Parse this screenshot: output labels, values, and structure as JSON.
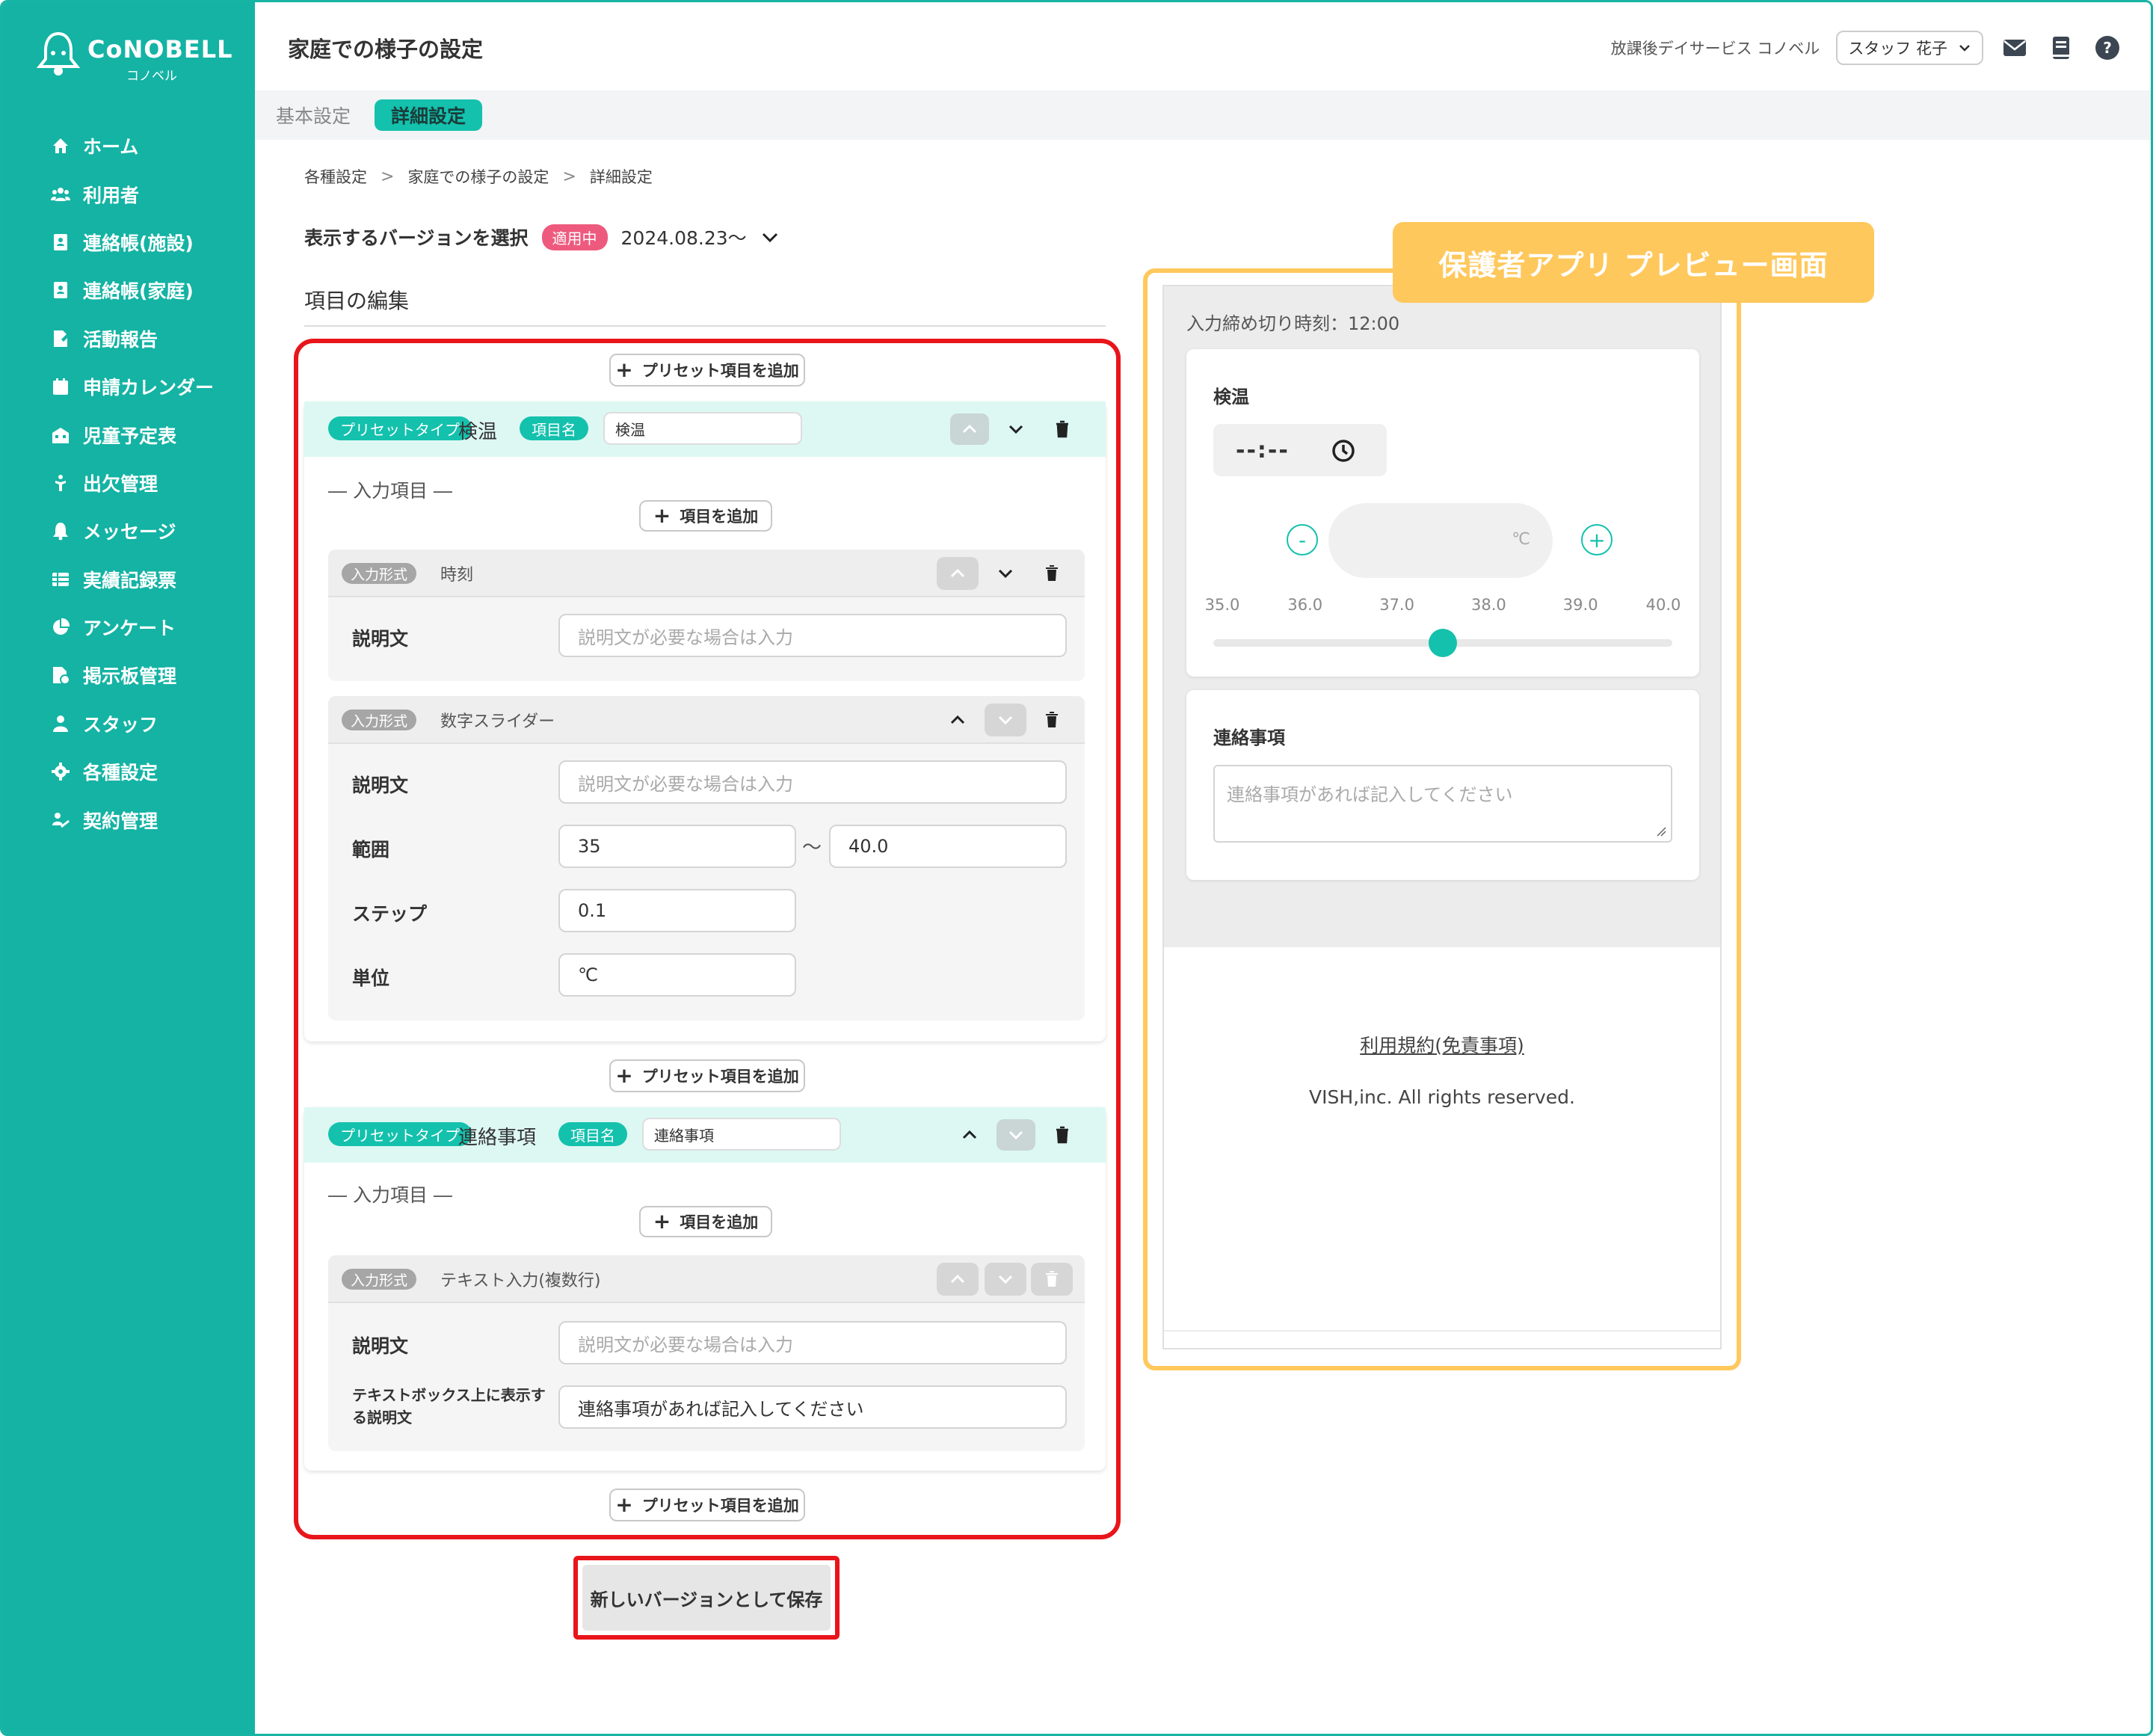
{
  "sidebar": {
    "brand": "CoNOBELL",
    "brand_sub": "コノベル",
    "items": [
      {
        "label": "ホーム",
        "icon": "home-icon"
      },
      {
        "label": "利用者",
        "icon": "users-icon"
      },
      {
        "label": "連絡帳(施設)",
        "icon": "contact-book-icon"
      },
      {
        "label": "連絡帳(家庭)",
        "icon": "contact-book-icon"
      },
      {
        "label": "活動報告",
        "icon": "report-icon"
      },
      {
        "label": "申請カレンダー",
        "icon": "calendar-icon"
      },
      {
        "label": "児童予定表",
        "icon": "schedule-icon"
      },
      {
        "label": "出欠管理",
        "icon": "attendance-icon"
      },
      {
        "label": "メッセージ",
        "icon": "bell-icon"
      },
      {
        "label": "実績記録票",
        "icon": "table-icon"
      },
      {
        "label": "アンケート",
        "icon": "pie-chart-icon"
      },
      {
        "label": "掲示板管理",
        "icon": "board-icon"
      },
      {
        "label": "スタッフ",
        "icon": "staff-icon"
      },
      {
        "label": "各種設定",
        "icon": "gear-icon"
      },
      {
        "label": "契約管理",
        "icon": "contract-icon"
      }
    ]
  },
  "header": {
    "title": "家庭での様子の設定",
    "facility": "放課後デイサービス コノベル",
    "user": "スタッフ 花子"
  },
  "tabs": [
    {
      "label": "基本設定",
      "active": false
    },
    {
      "label": "詳細設定",
      "active": true
    }
  ],
  "breadcrumb": [
    "各種設定",
    "家庭での様子の設定",
    "詳細設定"
  ],
  "version": {
    "label": "表示するバージョンを選択",
    "badge": "適用中",
    "date": "2024.08.23〜"
  },
  "editor": {
    "title": "項目の編集",
    "add_preset": "プリセット項目を追加",
    "add_item": "項目を追加",
    "input_items_label": "― 入力項目 ―",
    "preset_type_badge": "プリセットタイプ",
    "item_name_badge": "項目名",
    "input_format_badge": "入力形式",
    "presets": [
      {
        "name": "検温",
        "item_name": "検温",
        "fields": [
          {
            "type": "時刻",
            "description_label": "説明文",
            "description_placeholder": "説明文が必要な場合は入力"
          },
          {
            "type": "数字スライダー",
            "description_label": "説明文",
            "description_placeholder": "説明文が必要な場合は入力",
            "range_label": "範囲",
            "range_min": "35",
            "range_sep": "〜",
            "range_max": "40.0",
            "step_label": "ステップ",
            "step": "0.1",
            "unit_label": "単位",
            "unit": "℃"
          }
        ]
      },
      {
        "name": "連絡事項",
        "item_name": "連絡事項",
        "fields": [
          {
            "type": "テキスト入力(複数行)",
            "description_label": "説明文",
            "description_placeholder": "説明文が必要な場合は入力",
            "textbox_desc_label": "テキストボックス上に表示する説明文",
            "textbox_desc": "連絡事項があれば記入してください"
          }
        ]
      }
    ],
    "save_label": "新しいバージョンとして保存"
  },
  "preview": {
    "tag": "保護者アプリ プレビュー画面",
    "deadline": "入力締め切り時刻：12:00",
    "temp_title": "検温",
    "time_value": "--:--",
    "minus": "-",
    "plus": "+",
    "unit": "℃",
    "ticks": [
      "35.0",
      "36.0",
      "37.0",
      "38.0",
      "39.0",
      "40.0"
    ],
    "slider_value": 37.5,
    "notes_title": "連絡事項",
    "notes_placeholder": "連絡事項があれば記入してください",
    "terms": "利用規約(免責事項)",
    "copyright": "VISH,inc. All rights reserved."
  },
  "colors": {
    "brand": "#14b3a4",
    "accent": "#14c1ad",
    "active_badge": "#ee5a7e",
    "highlight_red": "#e8151b",
    "preview_yellow": "#ffc85c"
  }
}
